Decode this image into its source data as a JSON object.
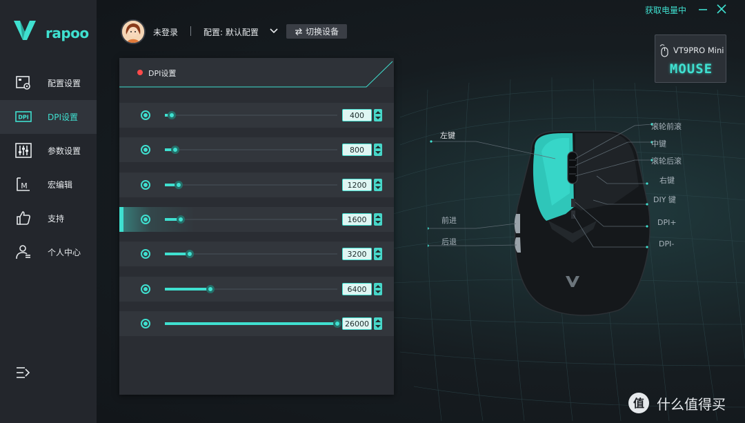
{
  "brand": {
    "name": "rapoo",
    "accent": "#3fe0d0"
  },
  "sidebar": {
    "items": [
      {
        "label": "配置设置",
        "icon": "profile-settings-icon",
        "active": false
      },
      {
        "label": "DPI设置",
        "icon": "dpi-icon",
        "active": true
      },
      {
        "label": "参数设置",
        "icon": "sliders-icon",
        "active": false
      },
      {
        "label": "宏编辑",
        "icon": "macro-icon",
        "active": false
      },
      {
        "label": "支持",
        "icon": "thumbs-up-icon",
        "active": false
      },
      {
        "label": "个人中心",
        "icon": "user-icon",
        "active": false
      }
    ],
    "dpi_icon_text": "DPI",
    "macro_icon_text": "M"
  },
  "header": {
    "login_status": "未登录",
    "config_label": "配置: 默认配置",
    "switch_device_label": "切换设备",
    "power_status": "获取电量中"
  },
  "device": {
    "name": "VT9PRO Mini",
    "type": "MOUSE"
  },
  "dpi_panel": {
    "title": "DPI设置",
    "max_dpi": 26000,
    "levels": [
      {
        "value": "400",
        "fraction": 0.04,
        "selected": false
      },
      {
        "value": "800",
        "fraction": 0.06,
        "selected": false
      },
      {
        "value": "1200",
        "fraction": 0.08,
        "selected": false
      },
      {
        "value": "1600",
        "fraction": 0.09,
        "selected": true
      },
      {
        "value": "3200",
        "fraction": 0.145,
        "selected": false
      },
      {
        "value": "6400",
        "fraction": 0.265,
        "selected": false
      },
      {
        "value": "26000",
        "fraction": 1.0,
        "selected": false
      }
    ]
  },
  "mouse_labels": {
    "left_button": "左键",
    "wheel_forward": "滚轮前滚",
    "middle_button": "中键",
    "wheel_backward": "滚轮后滚",
    "right_button": "右键",
    "diy_button": "DIY 键",
    "forward": "前进",
    "backward": "后退",
    "dpi_plus": "DPI+",
    "dpi_minus": "DPI-"
  }
}
